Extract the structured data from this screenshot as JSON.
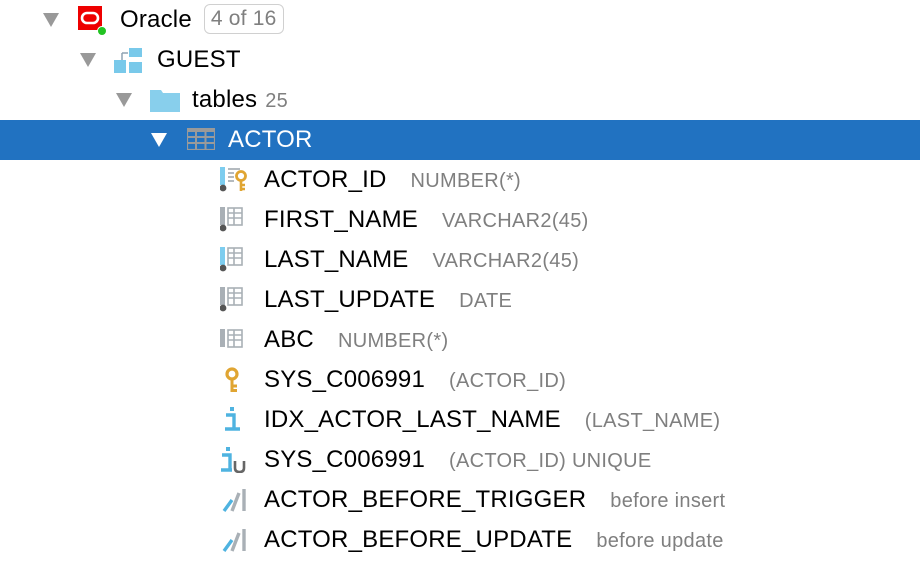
{
  "tree": {
    "root": {
      "label": "Oracle",
      "badge": "4 of 16",
      "icon": "oracle-datasource-icon",
      "expanded": true,
      "status_color": "#22c322",
      "brand_color": "#ee0000"
    },
    "schema": {
      "label": "GUEST",
      "icon": "schema-icon",
      "expanded": true
    },
    "tables_folder": {
      "label": "tables",
      "count": "25",
      "icon": "folder-icon",
      "expanded": true
    },
    "table": {
      "label": "ACTOR",
      "icon": "table-icon",
      "expanded": true,
      "selected": true,
      "selection_color": "#2172c1"
    },
    "children": [
      {
        "name": "ACTOR_ID",
        "detail": "NUMBER(*)",
        "icon": "primary-key-column-icon"
      },
      {
        "name": "FIRST_NAME",
        "detail": "VARCHAR2(45)",
        "icon": "not-null-column-icon"
      },
      {
        "name": "LAST_NAME",
        "detail": "VARCHAR2(45)",
        "icon": "indexed-not-null-column-icon"
      },
      {
        "name": "LAST_UPDATE",
        "detail": "DATE",
        "icon": "not-null-column-icon"
      },
      {
        "name": "ABC",
        "detail": "NUMBER(*)",
        "icon": "column-icon"
      },
      {
        "name": "SYS_C006991",
        "detail": "(ACTOR_ID)",
        "icon": "key-icon"
      },
      {
        "name": "IDX_ACTOR_LAST_NAME",
        "detail": "(LAST_NAME)",
        "icon": "index-icon"
      },
      {
        "name": "SYS_C006991",
        "detail": "(ACTOR_ID) UNIQUE",
        "icon": "unique-index-icon"
      },
      {
        "name": "ACTOR_BEFORE_TRIGGER",
        "detail": "before insert",
        "icon": "trigger-icon"
      },
      {
        "name": "ACTOR_BEFORE_UPDATE",
        "detail": "before update",
        "icon": "trigger-icon"
      }
    ]
  }
}
